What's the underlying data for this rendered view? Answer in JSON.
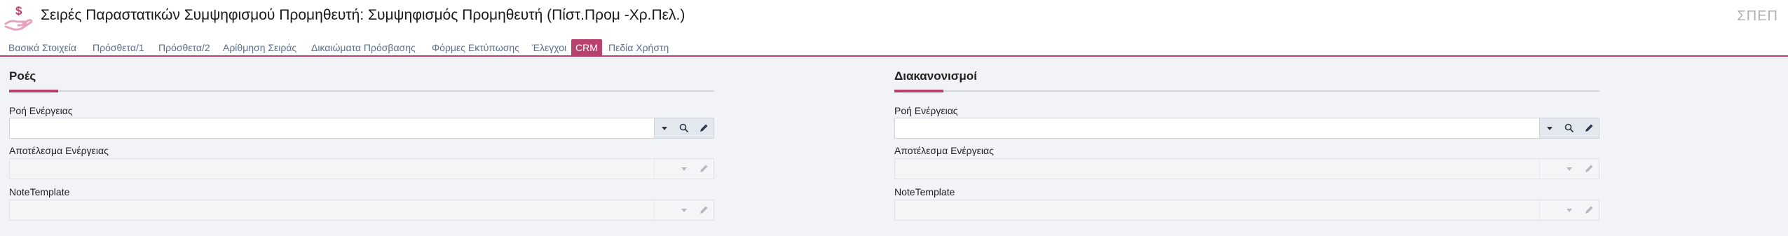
{
  "header": {
    "title": "Σειρές Παραστατικών Συμψηφισμού Προμηθευτή: Συμψηφισμός Προμηθευτή (Πίστ.Προμ -Χρ.Πελ.)",
    "code": "ΣΠΕΠ",
    "icon": "hand-money-icon"
  },
  "tabs": [
    {
      "label": "Βασικά Στοιχεία"
    },
    {
      "label": "Πρόσθετα/1"
    },
    {
      "label": "Πρόσθετα/2"
    },
    {
      "label": "Αρίθμηση Σειράς"
    },
    {
      "label": "Δικαιώματα Πρόσβασης"
    },
    {
      "label": "Φόρμες Εκτύπωσης"
    },
    {
      "label": "Έλεγχοι"
    },
    {
      "label": "CRM",
      "active": true
    },
    {
      "label": "Πεδία Χρήστη"
    }
  ],
  "panels": {
    "flows": {
      "title": "Ροές",
      "fields": [
        {
          "label": "Ροή Ενέργειας",
          "value": "",
          "enabled": true
        },
        {
          "label": "Αποτέλεσμα Ενέργειας",
          "value": "",
          "enabled": false
        },
        {
          "label": "NoteTemplate",
          "value": "",
          "enabled": false
        }
      ]
    },
    "settlements": {
      "title": "Διακανονισμοί",
      "fields": [
        {
          "label": "Ροή Ενέργειας",
          "value": "",
          "enabled": true
        },
        {
          "label": "Αποτέλεσμα Ενέργειας",
          "value": "",
          "enabled": false
        },
        {
          "label": "NoteTemplate",
          "value": "",
          "enabled": false
        }
      ]
    }
  },
  "colors": {
    "accent": "#b9416f",
    "tab_text": "#5b6f8a",
    "content_bg": "#f1f3f6"
  }
}
